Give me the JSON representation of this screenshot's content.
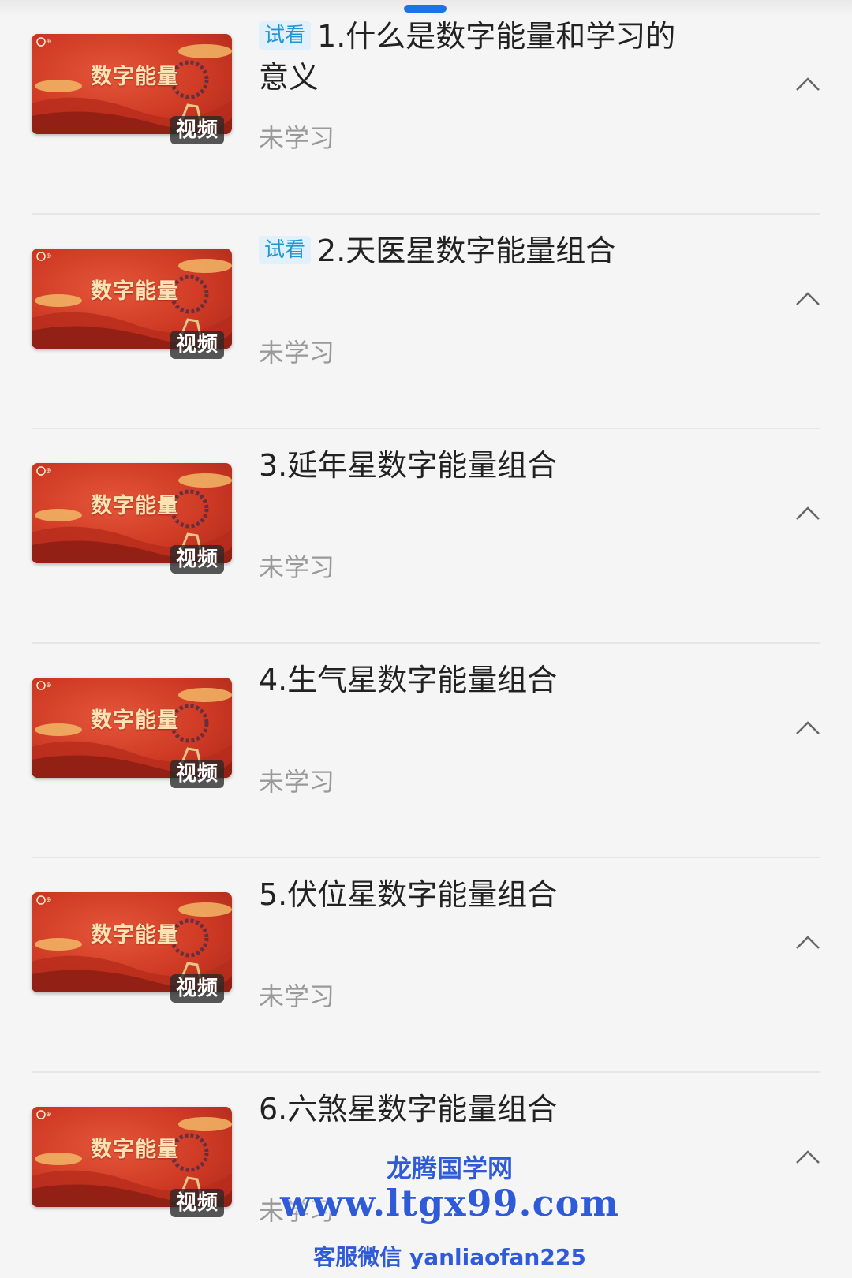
{
  "lessons": [
    {
      "trial": "试看",
      "title": "1.什么是数字能量和学习的意义",
      "status": "未学习",
      "thumb_title": "数字能量",
      "badge": "视频"
    },
    {
      "trial": "试看",
      "title": "2.天医星数字能量组合",
      "status": "未学习",
      "thumb_title": "数字能量",
      "badge": "视频"
    },
    {
      "trial": "",
      "title": "3.延年星数字能量组合",
      "status": "未学习",
      "thumb_title": "数字能量",
      "badge": "视频"
    },
    {
      "trial": "",
      "title": "4.生气星数字能量组合",
      "status": "未学习",
      "thumb_title": "数字能量",
      "badge": "视频"
    },
    {
      "trial": "",
      "title": "5.伏位星数字能量组合",
      "status": "未学习",
      "thumb_title": "数字能量",
      "badge": "视频"
    },
    {
      "trial": "",
      "title": "6.六煞星数字能量组合",
      "status": "未学习",
      "thumb_title": "数字能量",
      "badge": "视频"
    }
  ],
  "watermark": {
    "line1": "龙腾国学网",
    "line2": "www.ltgx99.com",
    "line3": "客服微信 yanliaofan225"
  },
  "icons": {
    "expand": "chevron-up-icon"
  },
  "colors": {
    "accent": "#1a73e8",
    "trial_tag_text": "#2196d3",
    "trial_tag_bg": "#e1f1fb",
    "title_text": "#222222",
    "status_text": "#999999",
    "thumbnail_red": "#cf3a24",
    "watermark": "#2f5ad8"
  }
}
